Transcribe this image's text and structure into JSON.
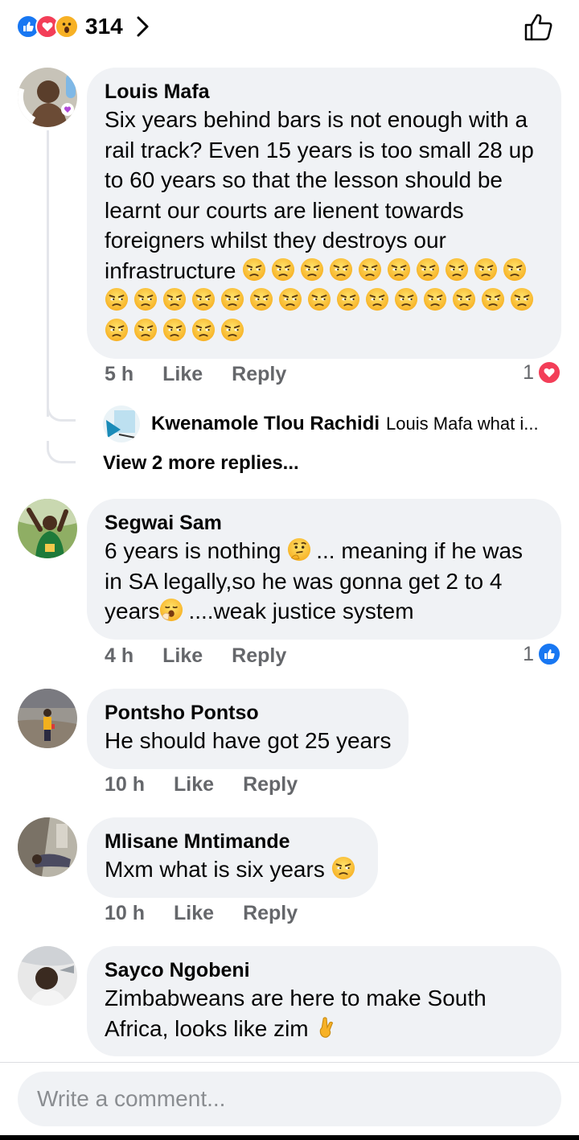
{
  "header": {
    "reaction_count": "314",
    "reactions": [
      "like",
      "love",
      "wow"
    ]
  },
  "comments": [
    {
      "author": "Louis Mafa",
      "text": "Six years behind bars is not enough with a rail track? Even 15 years is too small 28 up to 60 years so that the lesson should be learnt our courts are lienent towards foreigners whilst they destroys our infrastructure",
      "emoji": "unamused-face",
      "emoji_count": 30,
      "time": "5 h",
      "like_label": "Like",
      "reply_label": "Reply",
      "reaction_count": "1",
      "reaction_type": "love",
      "reply_preview": {
        "author": "Kwenamole Tlou Rachidi",
        "text": "Louis Mafa what i..."
      },
      "view_more": "View 2 more replies..."
    },
    {
      "author": "Segwai Sam",
      "text_parts": [
        "6 years is nothing",
        "... meaning if he was in SA legally,so he was gonna get 2 to 4 years",
        "....weak justice system"
      ],
      "emoji": [
        "thinking-face",
        "yawning-face"
      ],
      "time": "4 h",
      "like_label": "Like",
      "reply_label": "Reply",
      "reaction_count": "1",
      "reaction_type": "like"
    },
    {
      "author": "Pontsho Pontso",
      "text": "He should have got 25 years",
      "time": "10 h",
      "like_label": "Like",
      "reply_label": "Reply"
    },
    {
      "author": "Mlisane Mntimande",
      "text": "Mxm what is six years",
      "emoji": "unamused-face",
      "time": "10 h",
      "like_label": "Like",
      "reply_label": "Reply"
    },
    {
      "author": "Sayco Ngobeni",
      "text": "Zimbabweans are here to make South Africa, looks like zim",
      "emoji": "crossed-fingers"
    }
  ],
  "composer": {
    "placeholder": "Write a comment..."
  },
  "colors": {
    "like_blue": "#1877f2",
    "love_red": "#f33e58",
    "bubble_bg": "#f0f2f5",
    "meta_gray": "#65676b"
  }
}
